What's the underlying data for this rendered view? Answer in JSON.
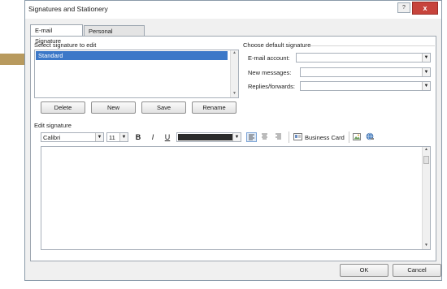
{
  "window": {
    "title": "Signatures and Stationery",
    "help_label": "?",
    "close_label": "x"
  },
  "tabs": [
    {
      "label": "E-mail Signature",
      "active": true
    },
    {
      "label": "Personal Stationery",
      "active": false
    }
  ],
  "select_section": {
    "label": "Select signature to edit",
    "signatures": [
      "Standard"
    ],
    "selected": "Standard"
  },
  "signature_buttons": {
    "delete": "Delete",
    "new": "New",
    "save": "Save",
    "rename": "Rename"
  },
  "default_section": {
    "label": "Choose default signature",
    "email_account_label": "E-mail account:",
    "email_account_value": "",
    "new_messages_label": "New messages:",
    "new_messages_value": "",
    "replies_label": "Replies/forwards:",
    "replies_value": ""
  },
  "edit_section": {
    "label": "Edit signature",
    "font": "Calibri",
    "size": "11",
    "bold": "B",
    "italic": "I",
    "underline": "U",
    "font_color": "#2b2b2b",
    "business_card": "Business Card"
  },
  "footer": {
    "ok": "OK",
    "cancel": "Cancel"
  },
  "colors": {
    "selection": "#3c78c8",
    "pointer_arrow": "#b89a5e",
    "close_button": "#c7443c"
  }
}
